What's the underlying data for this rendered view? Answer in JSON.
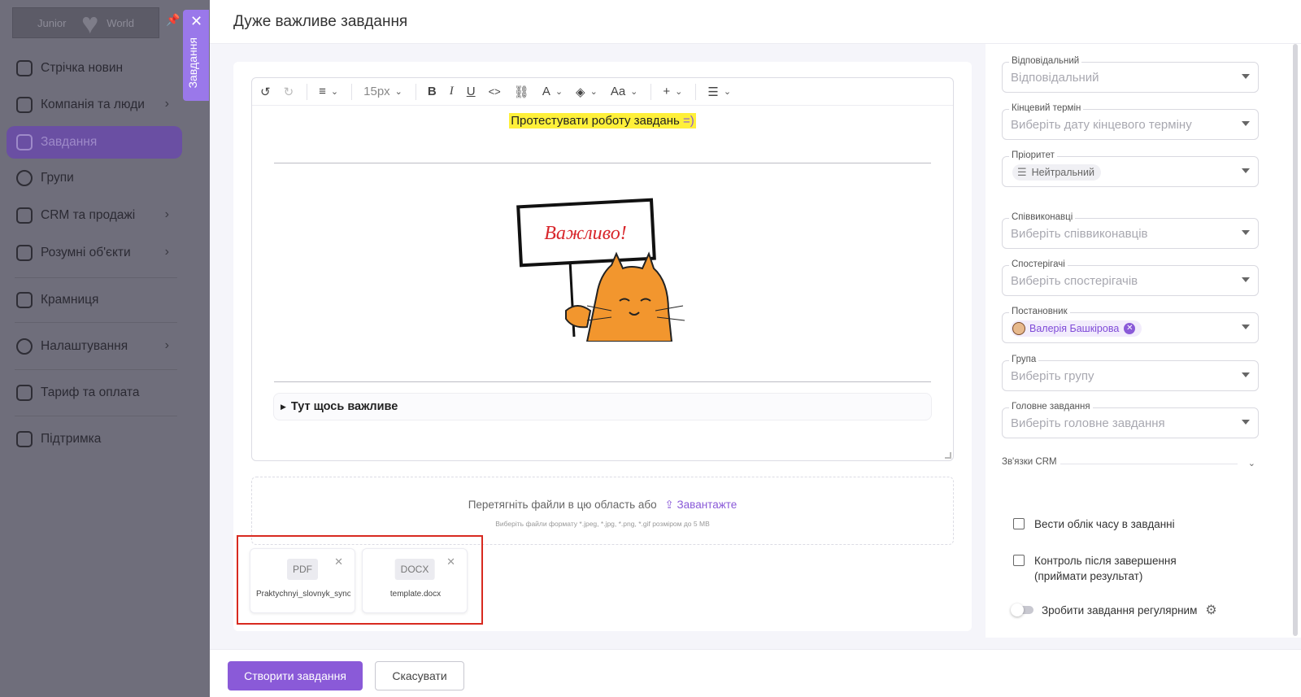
{
  "sidebar": {
    "logo": {
      "left": "Junior",
      "right": "World"
    },
    "items": [
      {
        "label": "Стрічка новин"
      },
      {
        "label": "Компанія та люди"
      },
      {
        "label": "Завдання"
      },
      {
        "label": "Групи"
      },
      {
        "label": "CRM та продажі"
      },
      {
        "label": "Розумні об'єкти"
      },
      {
        "label": "Крамниця"
      },
      {
        "label": "Налаштування"
      },
      {
        "label": "Тариф та оплата"
      },
      {
        "label": "Підтримка"
      }
    ],
    "tab_tag": "Завдання"
  },
  "modal": {
    "title": "Дуже важливе завдання"
  },
  "editor": {
    "font_size": "15px",
    "content_text": "Протестувати роботу завдань",
    "content_smile": "=)",
    "image_text": "Важливо!",
    "details_summary": "Тут щось важливе"
  },
  "upload": {
    "text": "Перетягніть файли в цю область або",
    "link": "Завантажте",
    "hint": "Виберіть файли формату *.jpeg, *.jpg, *.png, *.gif розміром до 5 МВ",
    "files": [
      {
        "type": "PDF",
        "name": "Praktychnyi_slovnyk_synonimiv.pdf"
      },
      {
        "type": "DOCX",
        "name": "template.docx"
      }
    ]
  },
  "form": {
    "responsible": {
      "label": "Відповідальний",
      "placeholder": "Відповідальний"
    },
    "deadline": {
      "label": "Кінцевий термін",
      "placeholder": "Виберіть дату кінцевого терміну"
    },
    "priority": {
      "label": "Пріоритет",
      "value": "Нейтральний"
    },
    "coexecutors": {
      "label": "Співвиконавці",
      "placeholder": "Виберіть співвиконавців"
    },
    "observers": {
      "label": "Спостерігачі",
      "placeholder": "Виберіть спостерігачів"
    },
    "author": {
      "label": "Постановник",
      "value": "Валерія Башкірова"
    },
    "group": {
      "label": "Група",
      "placeholder": "Виберіть групу"
    },
    "parent_task": {
      "label": "Головне завдання",
      "placeholder": "Виберіть головне завдання"
    },
    "crm_links": "Зв'язки CRM",
    "time_tracking": "Вести облік часу в завданні",
    "control_after": "Контроль після завершення (приймати результат)",
    "recurring": "Зробити завдання регулярним"
  },
  "footer": {
    "create": "Створити завдання",
    "cancel": "Скасувати"
  }
}
